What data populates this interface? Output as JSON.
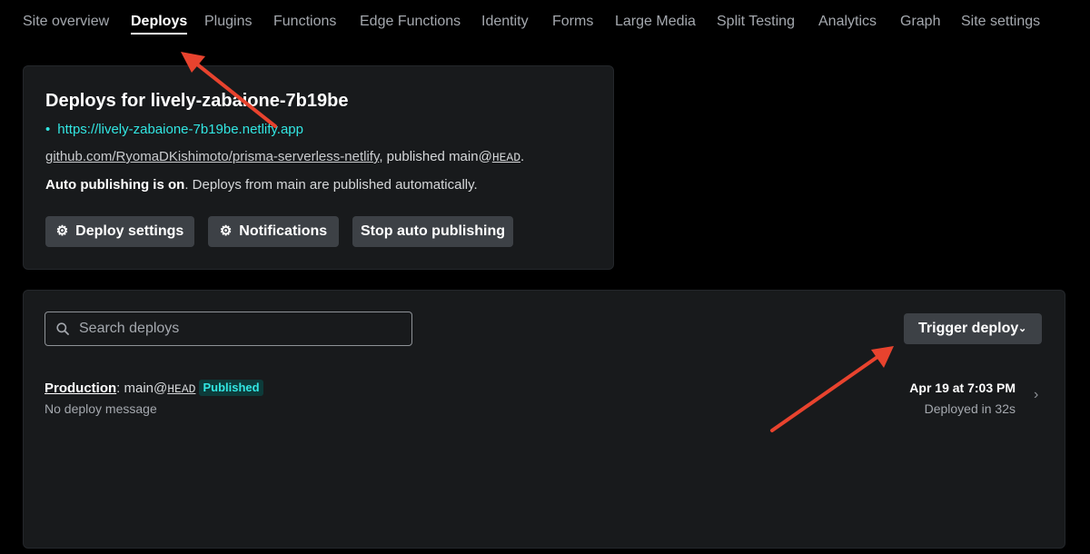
{
  "nav": {
    "tabs": [
      {
        "label": "Site overview",
        "active": false
      },
      {
        "label": "Deploys",
        "active": true
      },
      {
        "label": "Plugins",
        "active": false
      },
      {
        "label": "Functions",
        "active": false
      },
      {
        "label": "Edge Functions",
        "active": false
      },
      {
        "label": "Identity",
        "active": false
      },
      {
        "label": "Forms",
        "active": false
      },
      {
        "label": "Large Media",
        "active": false
      },
      {
        "label": "Split Testing",
        "active": false
      },
      {
        "label": "Analytics",
        "active": false
      },
      {
        "label": "Graph",
        "active": false
      },
      {
        "label": "Site settings",
        "active": false
      }
    ]
  },
  "site": {
    "title": "Deploys for lively-zabaione-7b19be",
    "url": "https://lively-zabaione-7b19be.netlify.app",
    "repo": "github.com/RyomaDKishimoto/prisma-serverless-netlify",
    "published_text": ", published main@",
    "ref": "HEAD",
    "published_end": ".",
    "auto_publish_bold": "Auto publishing is on",
    "auto_publish_rest": ". Deploys from main are published automatically.",
    "buttons": {
      "deploy_settings": "Deploy settings",
      "notifications": "Notifications",
      "stop_auto": "Stop auto publishing"
    }
  },
  "deploys": {
    "search_placeholder": "Search deploys",
    "trigger_label": "Trigger deploy",
    "items": [
      {
        "context": "Production",
        "branch_text": ": main@",
        "ref": "HEAD",
        "status": "Published",
        "message": "No deploy message",
        "date": "Apr 19 at 7:03 PM",
        "duration": "Deployed in 32s"
      }
    ]
  },
  "colors": {
    "background": "#000000",
    "card": "#181a1c",
    "button": "#3d4146",
    "teal_accent": "#32e6e2",
    "annotation_arrow": "#e8432e"
  },
  "icons": [
    "gear-icon",
    "search-icon",
    "chevron-down-icon",
    "chevron-right-icon"
  ]
}
